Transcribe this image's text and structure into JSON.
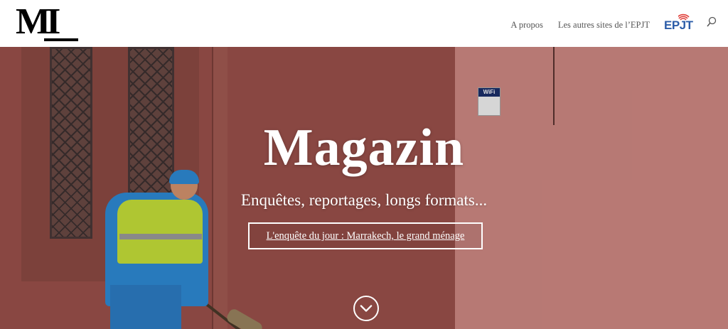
{
  "header": {
    "logo_text": "MI",
    "nav": [
      {
        "label": "A propos"
      },
      {
        "label": "Les autres sites de l’EPJT"
      }
    ],
    "epjt_logo_text": "EPJT",
    "search_icon": "search-icon"
  },
  "hero": {
    "title": "Magazin",
    "subtitle": "Enquêtes, reportages, longs formats...",
    "button_label": "L'enquête du jour : Marrakech, le grand ménage",
    "scroll_icon": "chevron-down-circle-icon",
    "sign_label": "WiFi"
  },
  "colors": {
    "hero_text": "#ffffff",
    "nav_text": "#555555",
    "epjt_blue": "#2b5ca8",
    "epjt_red": "#e0403a"
  }
}
